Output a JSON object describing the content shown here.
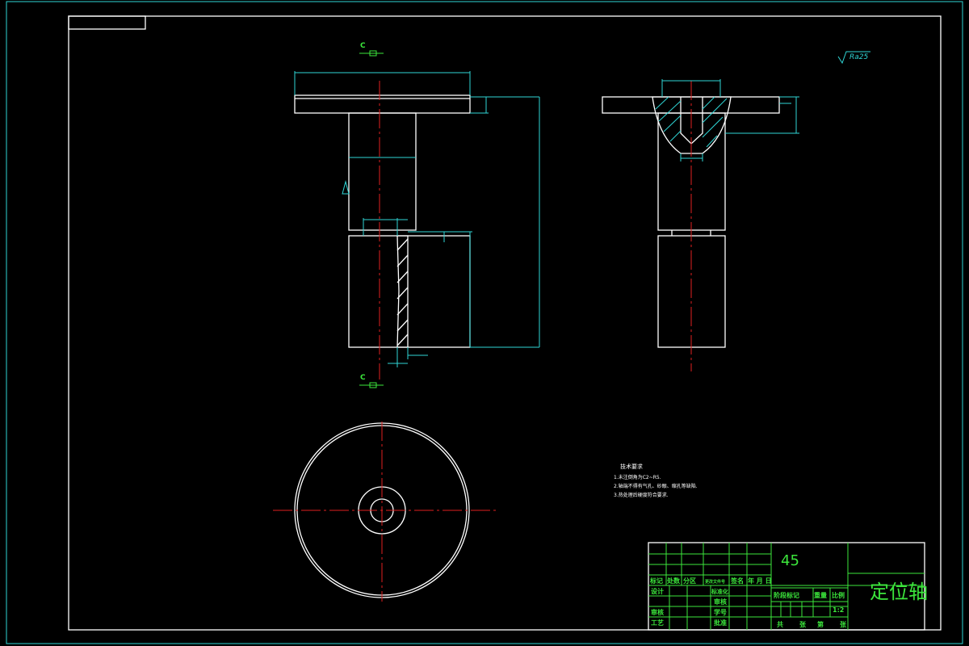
{
  "drawing": {
    "section_label_top": "C",
    "section_label_bottom": "C",
    "roughness": "Ra25",
    "material": "45",
    "part_name": "定位轴",
    "scale": "1:2",
    "tech_requirements": {
      "title": "技术要求",
      "lines": [
        "1.未注倒角为C2~R5.",
        "2.轴端不得有气孔、砂眼、缩孔等缺陷.",
        "3.热处理后硬度符合要求."
      ]
    },
    "title_block": {
      "headers": [
        "标记",
        "处数",
        "分区",
        "更改文件号",
        "签名",
        "年 月 日"
      ],
      "left_labels": [
        "设计",
        "审核",
        "工艺"
      ],
      "mid_labels": [
        "标准化",
        "审核",
        "学号",
        "批准"
      ],
      "stage_header": [
        "阶段标记",
        "重量",
        "比例"
      ],
      "sheet": [
        "共",
        "张",
        "第",
        "张"
      ]
    }
  },
  "colors": {
    "outline": "#ffffff",
    "dimension": "#2fd6d6",
    "centerline": "#e02020",
    "title_block": "#3ce63c"
  }
}
